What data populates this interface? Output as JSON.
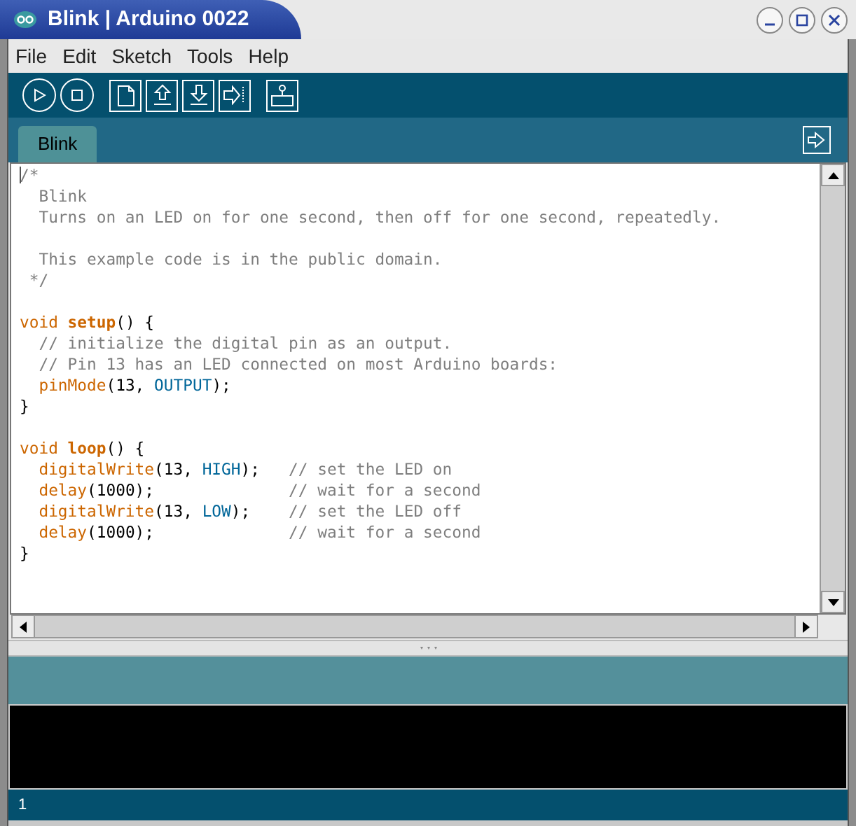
{
  "window": {
    "title": "Blink | Arduino 0022"
  },
  "menu": [
    "File",
    "Edit",
    "Sketch",
    "Tools",
    "Help"
  ],
  "tabs": [
    {
      "label": "Blink",
      "selected": true
    }
  ],
  "code_lines": [
    {
      "kind": "code",
      "tokens": [
        {
          "kind": "comment",
          "text": "/*"
        }
      ]
    },
    {
      "kind": "code",
      "tokens": [
        {
          "kind": "comment",
          "text": "  Blink"
        }
      ]
    },
    {
      "kind": "code",
      "tokens": [
        {
          "kind": "comment",
          "text": "  Turns on an LED on for one second, then off for one second, repeatedly."
        }
      ]
    },
    {
      "kind": "blank"
    },
    {
      "kind": "code",
      "tokens": [
        {
          "kind": "comment",
          "text": "  This example code is in the public domain."
        }
      ]
    },
    {
      "kind": "code",
      "tokens": [
        {
          "kind": "comment",
          "text": " */"
        }
      ]
    },
    {
      "kind": "blank"
    },
    {
      "kind": "code",
      "tokens": [
        {
          "kind": "keyword",
          "text": "void "
        },
        {
          "kind": "function_bold",
          "text": "setup"
        },
        {
          "kind": "plain",
          "text": "() {"
        }
      ]
    },
    {
      "kind": "code",
      "tokens": [
        {
          "kind": "comment",
          "text": "  // initialize the digital pin as an output."
        }
      ]
    },
    {
      "kind": "code",
      "tokens": [
        {
          "kind": "comment",
          "text": "  // Pin 13 has an LED connected on most Arduino boards:"
        }
      ]
    },
    {
      "kind": "code",
      "tokens": [
        {
          "kind": "function",
          "text": "  pinMode"
        },
        {
          "kind": "plain",
          "text": "(13, "
        },
        {
          "kind": "constant",
          "text": "OUTPUT"
        },
        {
          "kind": "plain",
          "text": ");"
        }
      ]
    },
    {
      "kind": "code",
      "tokens": [
        {
          "kind": "plain",
          "text": "}"
        }
      ]
    },
    {
      "kind": "blank"
    },
    {
      "kind": "code",
      "tokens": [
        {
          "kind": "keyword",
          "text": "void "
        },
        {
          "kind": "function_bold",
          "text": "loop"
        },
        {
          "kind": "plain",
          "text": "() {"
        }
      ]
    },
    {
      "kind": "code",
      "tokens": [
        {
          "kind": "function",
          "text": "  digitalWrite"
        },
        {
          "kind": "plain",
          "text": "(13, "
        },
        {
          "kind": "constant",
          "text": "HIGH"
        },
        {
          "kind": "plain",
          "text": ");   "
        },
        {
          "kind": "comment",
          "text": "// set the LED on"
        }
      ]
    },
    {
      "kind": "code",
      "tokens": [
        {
          "kind": "function",
          "text": "  delay"
        },
        {
          "kind": "plain",
          "text": "(1000);              "
        },
        {
          "kind": "comment",
          "text": "// wait for a second"
        }
      ]
    },
    {
      "kind": "code",
      "tokens": [
        {
          "kind": "function",
          "text": "  digitalWrite"
        },
        {
          "kind": "plain",
          "text": "(13, "
        },
        {
          "kind": "constant",
          "text": "LOW"
        },
        {
          "kind": "plain",
          "text": ");    "
        },
        {
          "kind": "comment",
          "text": "// set the LED off"
        }
      ]
    },
    {
      "kind": "code",
      "tokens": [
        {
          "kind": "function",
          "text": "  delay"
        },
        {
          "kind": "plain",
          "text": "(1000);              "
        },
        {
          "kind": "comment",
          "text": "// wait for a second"
        }
      ]
    },
    {
      "kind": "code",
      "tokens": [
        {
          "kind": "plain",
          "text": "}"
        }
      ]
    }
  ],
  "status_bar": {
    "line": "1"
  }
}
